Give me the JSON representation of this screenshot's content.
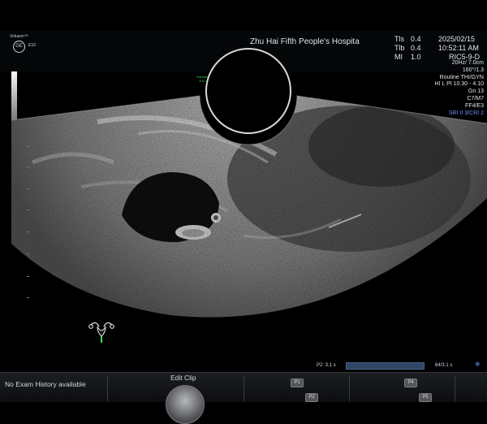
{
  "header": {
    "logo_text": "Voluson™",
    "logo_mark": "GE",
    "logo_probe": "E10",
    "hospital": "Zhu Hai Fifth People's Hospita",
    "tis_label": "Tls",
    "tis_value": "0.4",
    "tib_label": "Tlb",
    "tib_value": "0.4",
    "mi_label": "MI",
    "mi_value": "1.0",
    "date": "2025/02/15",
    "time": "10:52:11 AM",
    "probe": "RIC5-9-D"
  },
  "params": [
    "20Hz/ 7.0cm",
    "160°/1.3",
    "Routine THI/GYN",
    "HI L PI 10.30 - 4.10",
    "Gn  13",
    "C7/M7",
    "FF4/E3"
  ],
  "params_blue": "SRI II 3/CRI 2",
  "mini_probe": {
    "line1": "Voluson",
    "line2": "E10"
  },
  "cine": {
    "label": "P2: 3.1 s",
    "count": "64/3.1 s",
    "progress": 1.0
  },
  "footer": {
    "no_exam": "No Exam History available",
    "edit_clip": "Edit Clip",
    "softkeys": [
      "P1",
      "P4",
      "P2",
      "P5"
    ]
  },
  "colors": {
    "background": "#000000",
    "status_text": "#e0e4ee",
    "parameter_highlight": "#6e8cff",
    "probe_mark": "#3ddc5a",
    "cine_bar": "#2f4664"
  },
  "icons": [
    "ge-logo-icon",
    "uterus-pictogram-icon",
    "snowflake-icon",
    "edit-clip-dial-icon"
  ]
}
